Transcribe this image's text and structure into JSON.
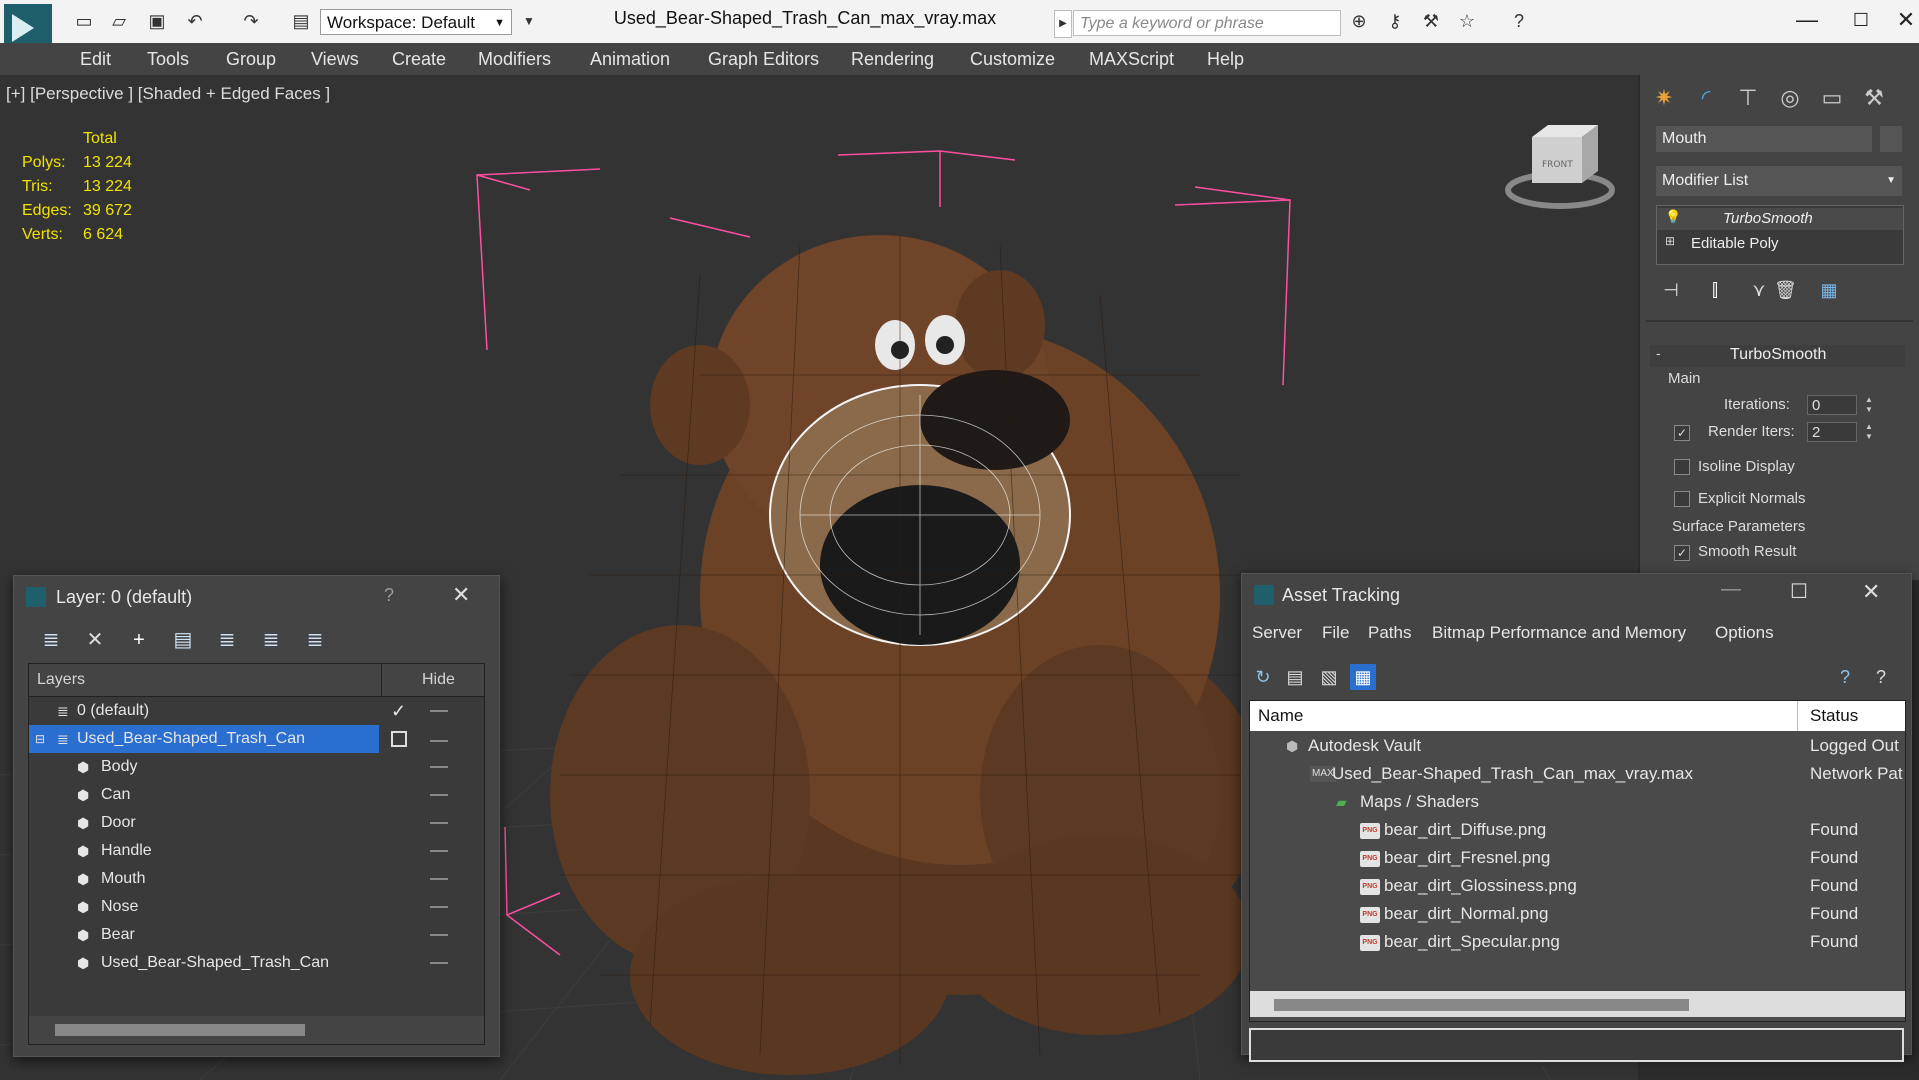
{
  "titlebar": {
    "workspace": "Workspace: Default",
    "file_title": "Used_Bear-Shaped_Trash_Can_max_vray.max",
    "search_placeholder": "Type a keyword or phrase"
  },
  "menubar": [
    "Edit",
    "Tools",
    "Group",
    "Views",
    "Create",
    "Modifiers",
    "Animation",
    "Graph Editors",
    "Rendering",
    "Customize",
    "MAXScript",
    "Help"
  ],
  "viewport": {
    "label": "[+] [Perspective ] [Shaded + Edged Faces ]",
    "stats_header": "Total",
    "stats": [
      {
        "label": "Polys:",
        "value": "13 224"
      },
      {
        "label": "Tris:",
        "value": "13 224"
      },
      {
        "label": "Edges:",
        "value": "39 672"
      },
      {
        "label": "Verts:",
        "value": "6 624"
      }
    ],
    "viewcube_text": "FRONT"
  },
  "command_panel": {
    "object_name": "Mouth",
    "modifier_list": "Modifier List",
    "stack": [
      "TurboSmooth",
      "Editable Poly"
    ],
    "rollout_title": "TurboSmooth",
    "main_group": "Main",
    "iterations_label": "Iterations:",
    "iterations_value": "0",
    "render_iters_label": "Render Iters:",
    "render_iters_value": "2",
    "isoline_label": "Isoline Display",
    "explicit_normals_label": "Explicit Normals",
    "surface_params_label": "Surface Parameters",
    "smooth_result_label": "Smooth Result"
  },
  "layer_dialog": {
    "title": "Layer: 0 (default)",
    "help": "?",
    "col_layers": "Layers",
    "col_hide": "Hide",
    "rows": [
      {
        "name": "0 (default)",
        "level": 0
      },
      {
        "name": "Used_Bear-Shaped_Trash_Can",
        "level": 0
      },
      {
        "name": "Body",
        "level": 1
      },
      {
        "name": "Can",
        "level": 1
      },
      {
        "name": "Door",
        "level": 1
      },
      {
        "name": "Handle",
        "level": 1
      },
      {
        "name": "Mouth",
        "level": 1
      },
      {
        "name": "Nose",
        "level": 1
      },
      {
        "name": "Bear",
        "level": 1
      },
      {
        "name": "Used_Bear-Shaped_Trash_Can",
        "level": 1
      }
    ]
  },
  "asset_tracking": {
    "title": "Asset Tracking",
    "menu": [
      "Server",
      "File",
      "Paths",
      "Bitmap Performance and Memory",
      "Options"
    ],
    "col_name": "Name",
    "col_status": "Status",
    "rows": [
      {
        "name": "Autodesk Vault",
        "status": "Logged Out"
      },
      {
        "name": "Used_Bear-Shaped_Trash_Can_max_vray.max",
        "status": "Network Pat"
      },
      {
        "name": "Maps / Shaders",
        "status": ""
      },
      {
        "name": "bear_dirt_Diffuse.png",
        "status": "Found"
      },
      {
        "name": "bear_dirt_Fresnel.png",
        "status": "Found"
      },
      {
        "name": "bear_dirt_Glossiness.png",
        "status": "Found"
      },
      {
        "name": "bear_dirt_Normal.png",
        "status": "Found"
      },
      {
        "name": "bear_dirt_Specular.png",
        "status": "Found"
      }
    ]
  },
  "colors": {
    "accent": "#1f5f6b",
    "selection": "#2a6fd0",
    "stats_yellow": "#f2e200",
    "bbox_pink": "#ff4fa0",
    "bear_brown": "#6b4226"
  },
  "png_badge": "PNG"
}
